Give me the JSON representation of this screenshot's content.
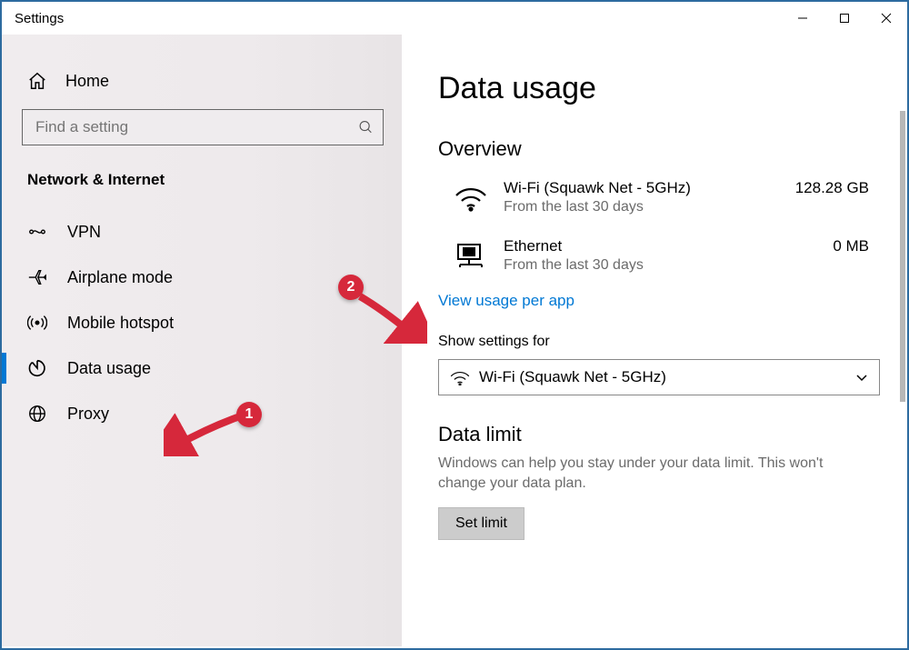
{
  "window": {
    "title": "Settings"
  },
  "sidebar": {
    "home_label": "Home",
    "search_placeholder": "Find a setting",
    "section_header": "Network & Internet",
    "items": [
      {
        "label": "VPN"
      },
      {
        "label": "Airplane mode"
      },
      {
        "label": "Mobile hotspot"
      },
      {
        "label": "Data usage"
      },
      {
        "label": "Proxy"
      }
    ]
  },
  "main": {
    "page_title": "Data usage",
    "overview_header": "Overview",
    "overview": [
      {
        "name": "Wi-Fi (Squawk Net - 5GHz)",
        "sub": "From the last 30 days",
        "value": "128.28 GB"
      },
      {
        "name": "Ethernet",
        "sub": "From the last 30 days",
        "value": "0 MB"
      }
    ],
    "view_link": "View usage per app",
    "show_settings_label": "Show settings for",
    "dropdown_value": "Wi-Fi (Squawk Net - 5GHz)",
    "data_limit_header": "Data limit",
    "data_limit_desc": "Windows can help you stay under your data limit. This won't change your data plan.",
    "set_limit_label": "Set limit"
  },
  "annotations": {
    "badge1": "1",
    "badge2": "2"
  }
}
